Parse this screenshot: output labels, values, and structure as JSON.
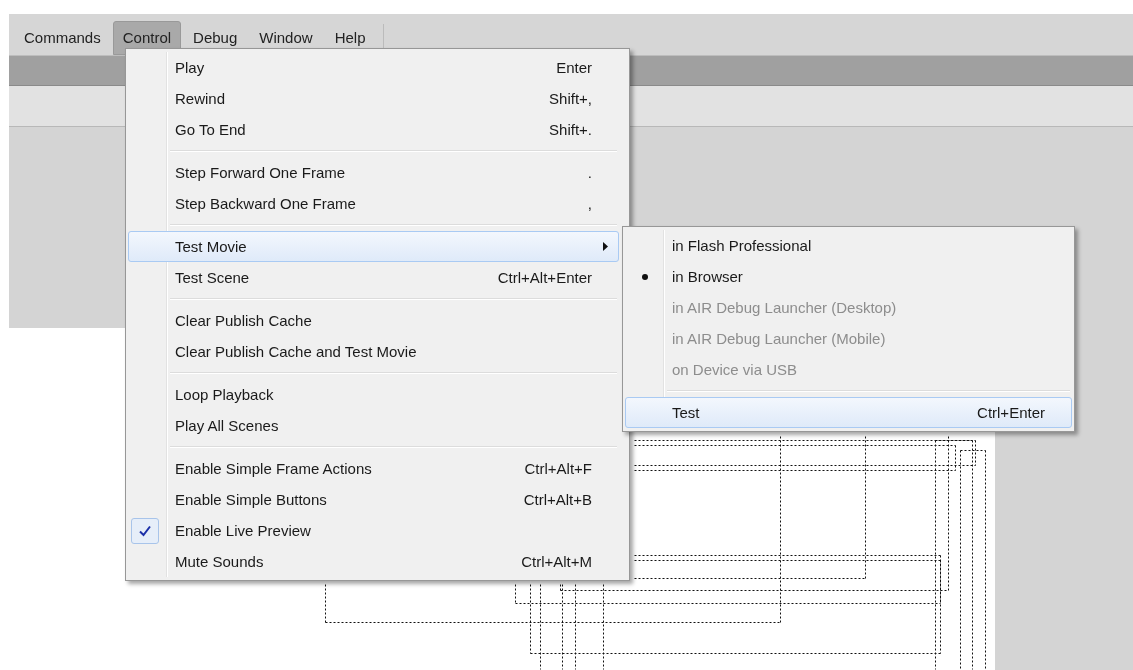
{
  "menubar": {
    "items": [
      {
        "label": "Commands",
        "selected": false
      },
      {
        "label": "Control",
        "selected": true
      },
      {
        "label": "Debug",
        "selected": false
      },
      {
        "label": "Window",
        "selected": false
      },
      {
        "label": "Help",
        "selected": false
      }
    ]
  },
  "control_menu": {
    "groups": [
      [
        {
          "kind": "command",
          "label": "Play",
          "shortcut": "Enter",
          "checked": false,
          "highlighted": false
        },
        {
          "kind": "command",
          "label": "Rewind",
          "shortcut": "Shift+,",
          "checked": false,
          "highlighted": false
        },
        {
          "kind": "command",
          "label": "Go To End",
          "shortcut": "Shift+.",
          "checked": false,
          "highlighted": false
        }
      ],
      [
        {
          "kind": "command",
          "label": "Step Forward One Frame",
          "shortcut": ".",
          "checked": false,
          "highlighted": false
        },
        {
          "kind": "command",
          "label": "Step Backward One Frame",
          "shortcut": ",",
          "checked": false,
          "highlighted": false
        }
      ],
      [
        {
          "kind": "submenu",
          "label": "Test Movie",
          "checked": false,
          "highlighted": true
        },
        {
          "kind": "command",
          "label": "Test Scene",
          "shortcut": "Ctrl+Alt+Enter",
          "checked": false,
          "highlighted": false
        }
      ],
      [
        {
          "kind": "command",
          "label": "Clear Publish Cache",
          "checked": false,
          "highlighted": false
        },
        {
          "kind": "command",
          "label": "Clear Publish Cache and Test Movie",
          "checked": false,
          "highlighted": false
        }
      ],
      [
        {
          "kind": "command",
          "label": "Loop Playback",
          "checked": false,
          "highlighted": false
        },
        {
          "kind": "command",
          "label": "Play All Scenes",
          "checked": false,
          "highlighted": false
        }
      ],
      [
        {
          "kind": "command",
          "label": "Enable Simple Frame Actions",
          "shortcut": "Ctrl+Alt+F",
          "checked": false,
          "highlighted": false
        },
        {
          "kind": "command",
          "label": "Enable Simple Buttons",
          "shortcut": "Ctrl+Alt+B",
          "checked": false,
          "highlighted": false
        },
        {
          "kind": "command",
          "label": "Enable Live Preview",
          "checked": true,
          "highlighted": false
        },
        {
          "kind": "command",
          "label": "Mute Sounds",
          "shortcut": "Ctrl+Alt+M",
          "checked": false,
          "highlighted": false
        }
      ]
    ]
  },
  "test_movie_submenu": {
    "groups": [
      [
        {
          "kind": "option",
          "label": "in Flash Professional",
          "checked": false,
          "disabled": false,
          "highlighted": false
        },
        {
          "kind": "option",
          "label": "in Browser",
          "checked": true,
          "disabled": false,
          "highlighted": false
        },
        {
          "kind": "option",
          "label": "in AIR Debug Launcher (Desktop)",
          "checked": false,
          "disabled": true,
          "highlighted": false
        },
        {
          "kind": "option",
          "label": "in AIR Debug Launcher (Mobile)",
          "checked": false,
          "disabled": true,
          "highlighted": false
        },
        {
          "kind": "option",
          "label": "on Device via USB",
          "checked": false,
          "disabled": true,
          "highlighted": false
        }
      ],
      [
        {
          "kind": "command",
          "label": "Test",
          "shortcut": "Ctrl+Enter",
          "checked": false,
          "disabled": false,
          "highlighted": true
        }
      ]
    ]
  }
}
